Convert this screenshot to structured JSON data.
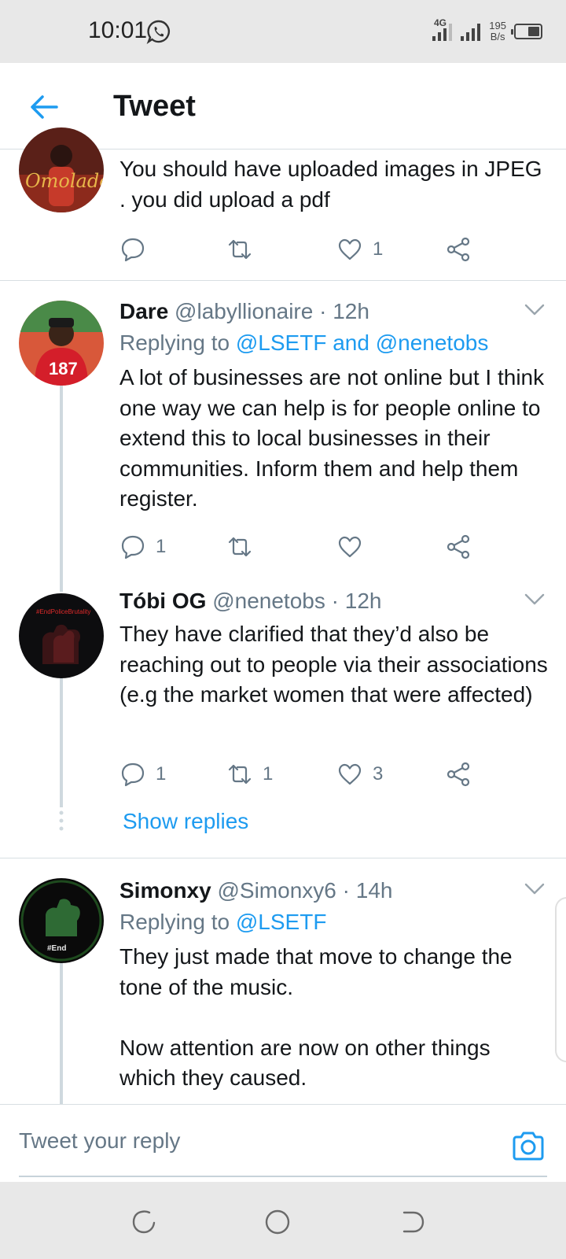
{
  "status": {
    "time": "10:01",
    "network": "4G",
    "speed_value": "195",
    "speed_unit": "B/s"
  },
  "header": {
    "title": "Tweet"
  },
  "tweets": [
    {
      "body": "You should have uploaded images in JPEG . you did upload a pdf",
      "reply_count": "",
      "retweet_count": "",
      "like_count": "1"
    },
    {
      "name": "Dare",
      "handle": "@labyllionaire",
      "time": "· 12h",
      "replying_prefix": "Replying to",
      "replying_to": "@LSETF and @nenetobs",
      "body": "A lot of businesses are not online but I think one way we can help is for people online to extend this to local businesses in their communities. Inform them and help them register.",
      "reply_count": "1",
      "retweet_count": "",
      "like_count": ""
    },
    {
      "name": "Tóbi OG",
      "handle": "@nenetobs",
      "time": "· 12h",
      "body": "They have clarified that they’d also be reaching out to people via their associations (e.g the market women that were affected)",
      "reply_count": "1",
      "retweet_count": "1",
      "like_count": "3",
      "show_replies": "Show replies"
    },
    {
      "name": "Simonxy",
      "handle": "@Simonxy6",
      "time": "· 14h",
      "replying_prefix": "Replying to",
      "replying_to": "@LSETF",
      "body": "They just made that move to change the tone of the music.\n\nNow attention are now on other things which they caused."
    }
  ],
  "reply_bar": {
    "placeholder": "Tweet your reply"
  },
  "colors": {
    "accent": "#1d9bf0",
    "muted": "#657786",
    "text": "#14171a",
    "bar_bg": "#e8e8e8"
  },
  "icons": [
    "whatsapp-icon",
    "signal-icon",
    "battery-icon",
    "back-arrow-icon",
    "chevron-down-icon",
    "reply-icon",
    "retweet-icon",
    "like-icon",
    "share-icon",
    "camera-icon",
    "recents-nav-icon",
    "home-nav-icon",
    "back-nav-icon"
  ]
}
